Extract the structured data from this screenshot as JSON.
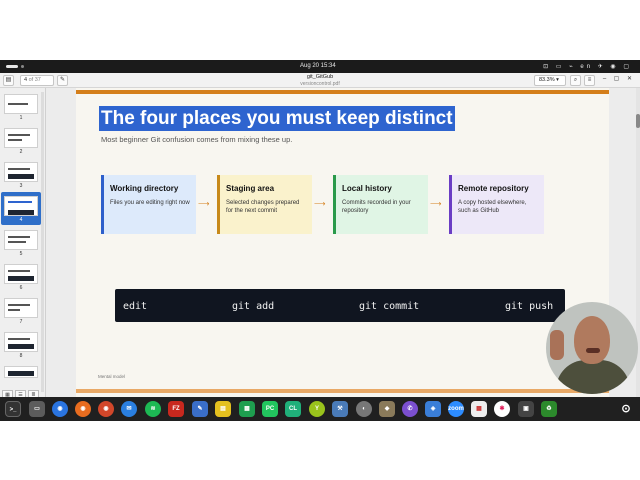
{
  "topbar": {
    "clock": "Aug 20  15:34",
    "status_icons": "⊡ ▭ ⌁ en ✈ ◉ ▢"
  },
  "viewer": {
    "page_current": "4",
    "page_total": "of 37",
    "doc_title": "git_GitGub",
    "doc_subtitle": "versioncontrol.pdf",
    "zoom": "83.3%",
    "search_icon": "search-icon",
    "menu_icon": "menu-icon"
  },
  "sidebar": {
    "thumbs": [
      {
        "num": "1"
      },
      {
        "num": "2"
      },
      {
        "num": "3"
      },
      {
        "num": "4",
        "selected": true
      },
      {
        "num": "5"
      },
      {
        "num": "6"
      },
      {
        "num": "7"
      },
      {
        "num": "8"
      }
    ]
  },
  "slide": {
    "title": "The four places you must keep distinct",
    "subtitle": "Most beginner Git confusion comes from mixing these up.",
    "cards": [
      {
        "title": "Working directory",
        "desc": "Files you are editing right now",
        "color": "#2d5fcb",
        "bg": "#ddeafb"
      },
      {
        "title": "Staging area",
        "desc": "Selected changes prepared for the next commit",
        "color": "#c7891a",
        "bg": "#faf2cc"
      },
      {
        "title": "Local history",
        "desc": "Commits recorded in your repository",
        "color": "#2a9a4a",
        "bg": "#e0f5e5"
      },
      {
        "title": "Remote repository",
        "desc": "A copy hosted elsewhere, such as GitHub",
        "color": "#6a3dc4",
        "bg": "#ede8f8"
      }
    ],
    "commands": [
      "edit",
      "git add",
      "git commit",
      "git push"
    ],
    "footer": "Mental model"
  },
  "dock": {
    "apps": [
      "terminal-icon",
      "files-icon",
      "chrome-icon",
      "firefox-icon",
      "thunderbird-icon",
      "spotify-icon",
      "filezilla-icon",
      "editor-icon",
      "notes-icon",
      "sheets-icon",
      "pycharm-icon",
      "clion-icon",
      "yarn-icon",
      "tools-icon",
      "gimp-icon",
      "settings-icon",
      "viber-icon",
      "bitwarden-icon",
      "zoom-icon",
      "calendar-icon",
      "slack-icon",
      "trash-icon"
    ]
  }
}
